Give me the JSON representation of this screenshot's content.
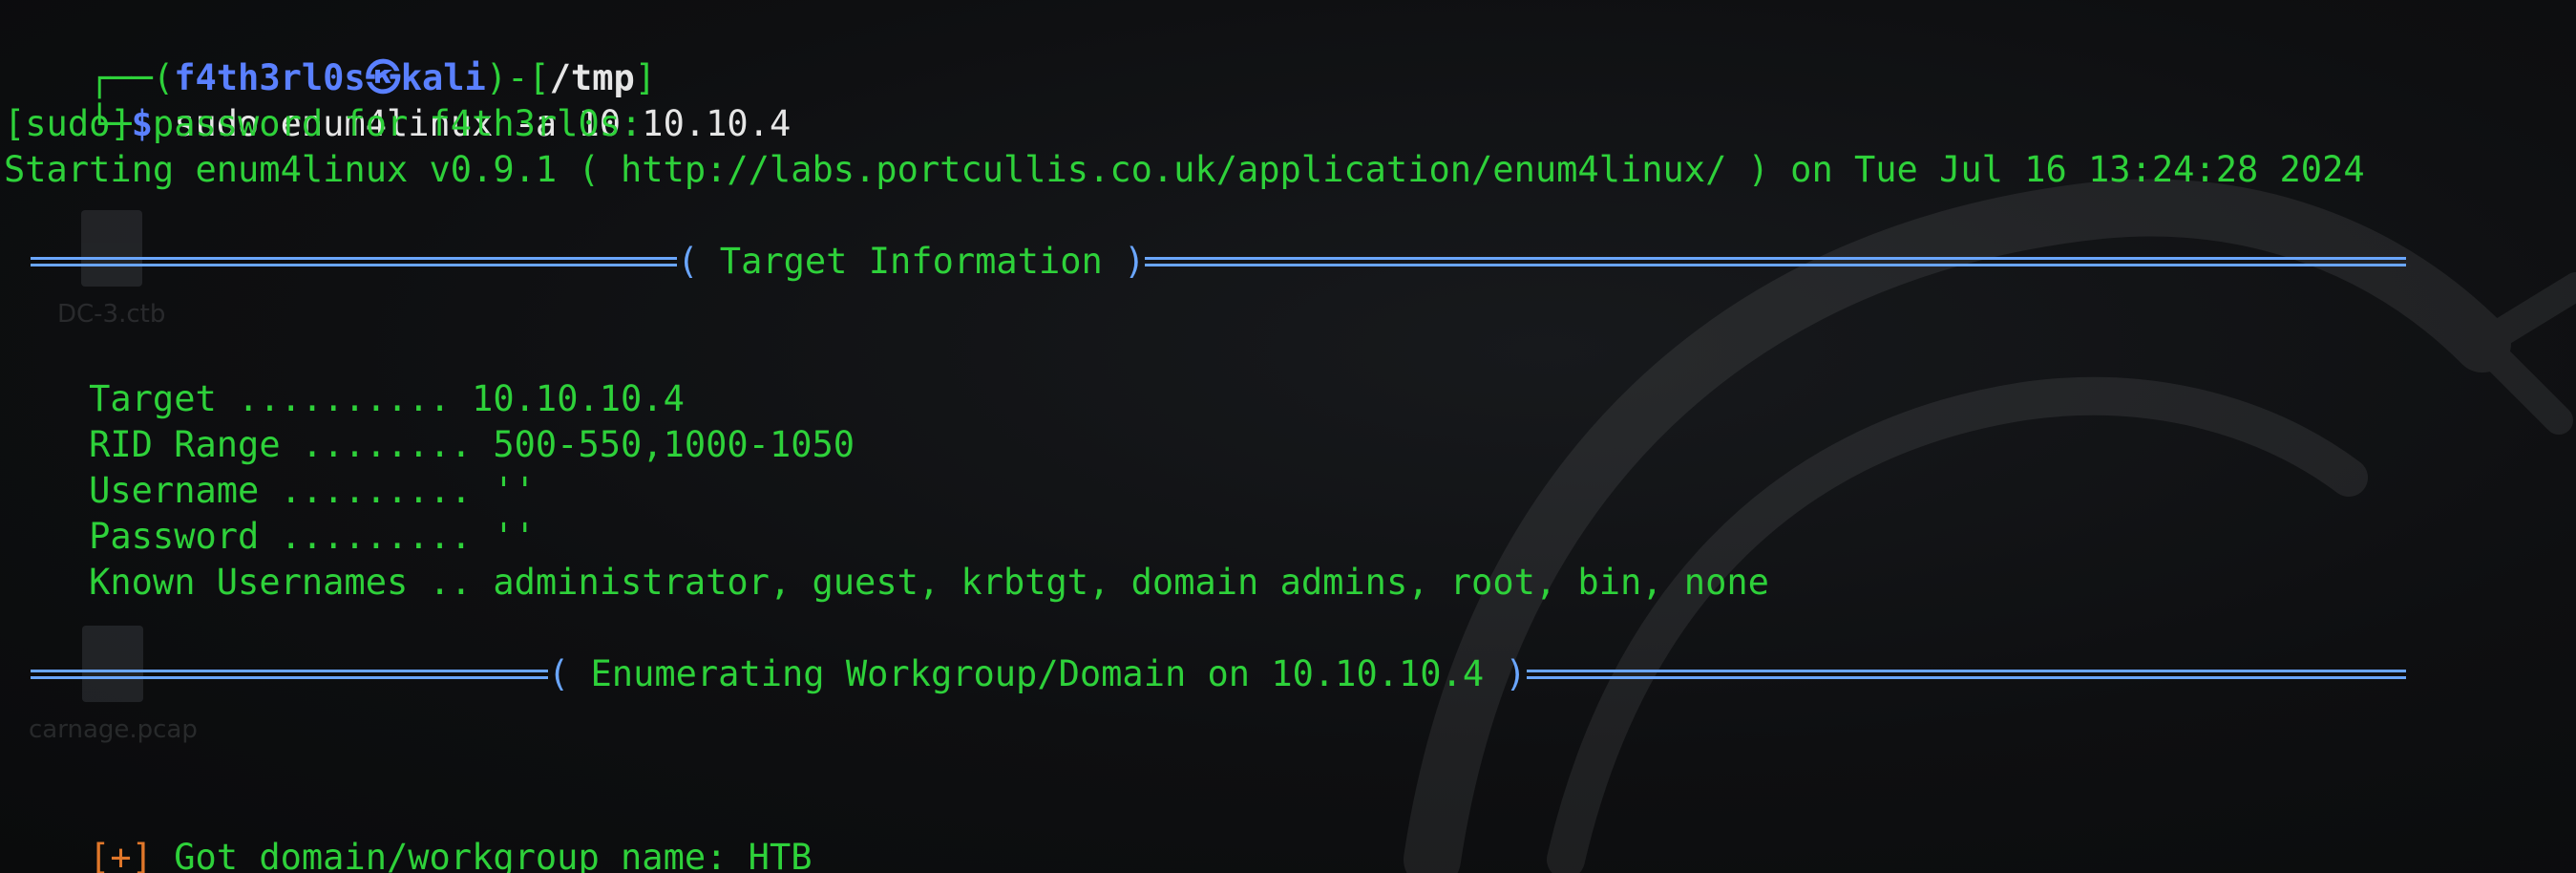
{
  "prompt": {
    "user": "f4th3rl0s",
    "skull_glyph": "㉿",
    "host": "kali",
    "dir": "/tmp",
    "symbol": "$",
    "command": "sudo enum4linux -a 10.10.10.4"
  },
  "sudo_prompt": "[sudo] password for f4th3rl0s:",
  "start_line": "Starting enum4linux v0.9.1 ( http://labs.portcullis.co.uk/application/enum4linux/ ) on Tue Jul 16 13:24:28 2024",
  "section_target": {
    "title": " Target Information "
  },
  "target_info": [
    {
      "key": "Target ..........",
      "value": "10.10.10.4"
    },
    {
      "key": "RID Range ........",
      "value": "500-550,1000-1050"
    },
    {
      "key": "Username .........",
      "value": "''"
    },
    {
      "key": "Password .........",
      "value": "''"
    },
    {
      "key": "Known Usernames ..",
      "value": "administrator, guest, krbtgt, domain admins, root, bin, none"
    }
  ],
  "section_workgroup": {
    "title": " Enumerating Workgroup/Domain on 10.10.10.4 "
  },
  "result": {
    "marker": "[+]",
    "text": "Got domain/workgroup name: HTB"
  },
  "desktop_icons": [
    {
      "label": "DC-3.ctb"
    },
    {
      "label": "carnage.pcap"
    }
  ],
  "colors": {
    "green": "#2ed13a",
    "blue": "#5a80ff",
    "rule": "#6aa6ff",
    "orange": "#e0772a",
    "background": "#0e0f11"
  }
}
